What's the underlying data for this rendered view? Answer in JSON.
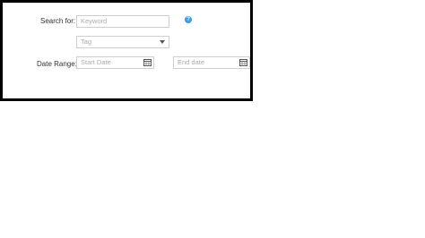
{
  "search": {
    "label": "Search for:",
    "placeholder": "Keyword",
    "help_icon": "question-circle-icon",
    "help_glyph": "?",
    "help_color": "#3b9ce8"
  },
  "tag": {
    "placeholder": "Tag",
    "icon": "chevron-down-icon"
  },
  "date_range": {
    "label": "Date Range:",
    "start_placeholder": "Start Date",
    "end_placeholder": "End date",
    "icon": "calendar-icon"
  }
}
